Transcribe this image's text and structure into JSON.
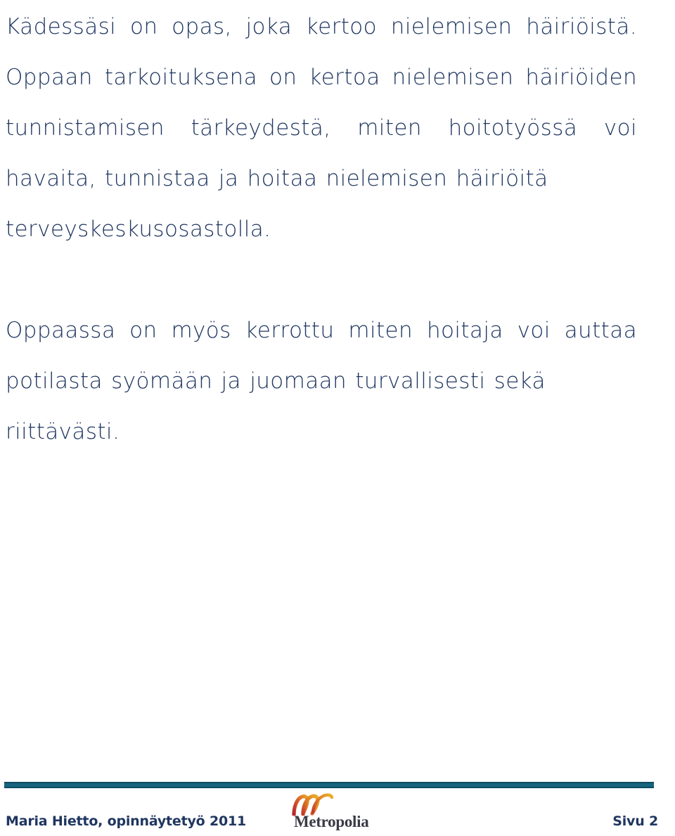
{
  "document": {
    "page_background": "#ffffff",
    "body_text_color": "#1f3660",
    "footer_rule_color": "#16657f",
    "logo_mark_colors": [
      "#c0392b",
      "#e0622a",
      "#e8a020"
    ],
    "logo_word_color": "#3b3b47"
  },
  "body": {
    "paragraphs": [
      {
        "id": "paragraph-one",
        "text": "Kädessäsi on opas, joka kertoo nielemisen häiriöistä. Oppaan tarkoituksena on kertoa nielemisen häiriöiden tunnistamisen tärkeydestä, miten hoitotyössä voi havaita, tunnistaa ja hoitaa nielemisen häiriöitä",
        "last_line": "terveyskeskusosastolla.",
        "lines": [
          "Kädessäsi on opas, joka kertoo nielemisen häiriöistä.",
          "Oppaan tarkoituksena on kertoa nielemisen häiriöiden",
          "tunnistamisen tärkeydestä, miten hoitotyössä voi",
          "havaita, tunnistaa ja hoitaa nielemisen häiriöitä",
          "terveyskeskusosastolla."
        ]
      },
      {
        "id": "paragraph-two",
        "text": "Oppaassa on myös kerrottu miten hoitaja voi auttaa potilasta syömään ja juomaan turvallisesti sekä",
        "last_line": "riittävästi.",
        "lines": [
          "Oppaassa on myös  kerrottu miten hoitaja voi auttaa",
          "potilasta syömään ja juomaan turvallisesti sekä",
          "riittävästi."
        ]
      }
    ]
  },
  "footer": {
    "author_line": "Maria Hietto, opinnäytetyö 2011",
    "page_label": "Sivu 2",
    "logo": {
      "name": "metropolia-logo",
      "wordmark": "Metropolia"
    }
  }
}
